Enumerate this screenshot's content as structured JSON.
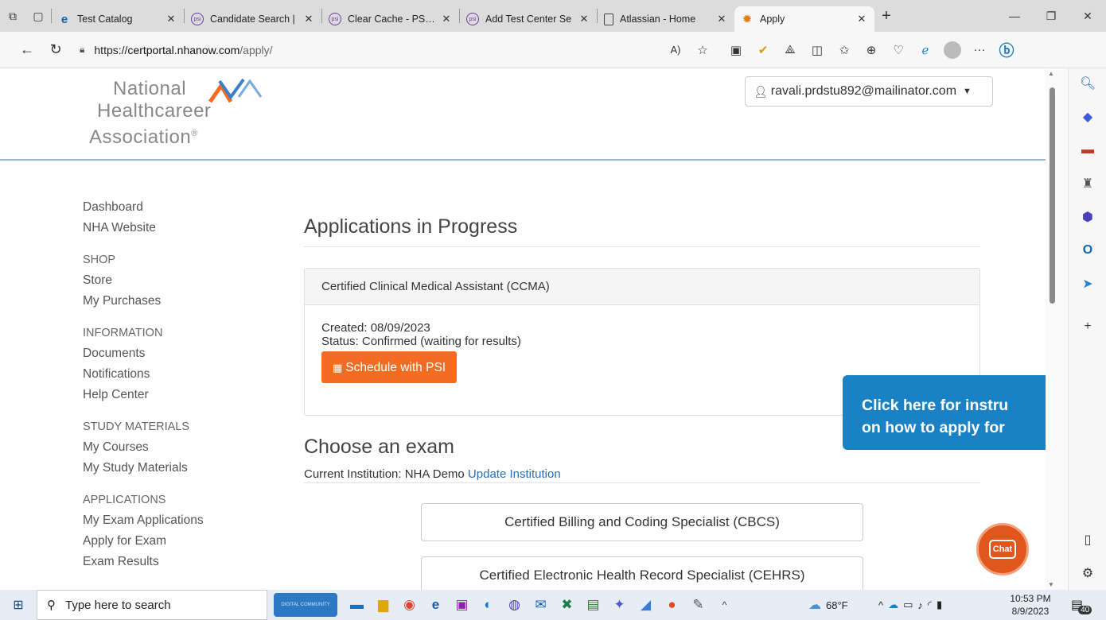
{
  "browser": {
    "tabs": [
      {
        "label": "Test Catalog",
        "icon": "ie-icon",
        "active": false
      },
      {
        "label": "Candidate Search |",
        "icon": "psi-icon",
        "active": false
      },
      {
        "label": "Clear Cache - PSI E",
        "icon": "psi-icon",
        "active": false
      },
      {
        "label": "Add Test Center Se",
        "icon": "psi-icon",
        "active": false
      },
      {
        "label": "Atlassian - Home",
        "icon": "page-icon",
        "active": false
      },
      {
        "label": "Apply",
        "icon": "gear-icon",
        "active": true
      }
    ],
    "url_prefix": "https://",
    "url_domain": "certportal.nhanow.com",
    "url_path": "/apply/"
  },
  "header": {
    "logo_line1": "National",
    "logo_line2": "Healthcareer",
    "logo_line3": "Association",
    "logo_reg": "®",
    "user_email": "ravali.prdstu892@mailinator.com",
    "colors": {
      "header_line": "#9ab7d8"
    }
  },
  "sidebar": {
    "top_links": [
      "Dashboard",
      "NHA Website"
    ],
    "sections": [
      {
        "heading": "SHOP",
        "items": [
          "Store",
          "My Purchases"
        ]
      },
      {
        "heading": "INFORMATION",
        "items": [
          "Documents",
          "Notifications",
          "Help Center"
        ]
      },
      {
        "heading": "STUDY MATERIALS",
        "items": [
          "My Courses",
          "My Study Materials"
        ]
      },
      {
        "heading": "APPLICATIONS",
        "items": [
          "My Exam Applications",
          "Apply for Exam",
          "Exam Results"
        ]
      }
    ]
  },
  "main": {
    "in_progress_title": "Applications in Progress",
    "application": {
      "name": "Certified Clinical Medical Assistant (CCMA)",
      "created": "Created: 08/09/2023",
      "status": "Status: Confirmed (waiting for results)",
      "schedule_label": "Schedule with PSI"
    },
    "choose_title": "Choose an exam",
    "institution_label": "Current Institution: NHA Demo",
    "update_institution": "Update Institution",
    "exams": [
      "Certified Billing and Coding Specialist (CBCS)",
      "Certified Electronic Health Record Specialist (CEHRS)"
    ],
    "instructions_line1": "Click here for instru",
    "instructions_line2": "on how to apply for",
    "chat_label": "Chat",
    "colors": {
      "orange": "#f36c21",
      "banner_blue": "#1a82c4",
      "link_blue": "#2a6fb0"
    }
  },
  "taskbar": {
    "search_placeholder": "Type here to search",
    "promo_text": "DIGITAL COMMUNITY",
    "weather": "68°F",
    "time": "10:53 PM",
    "date": "8/9/2023",
    "notifications": "40"
  }
}
